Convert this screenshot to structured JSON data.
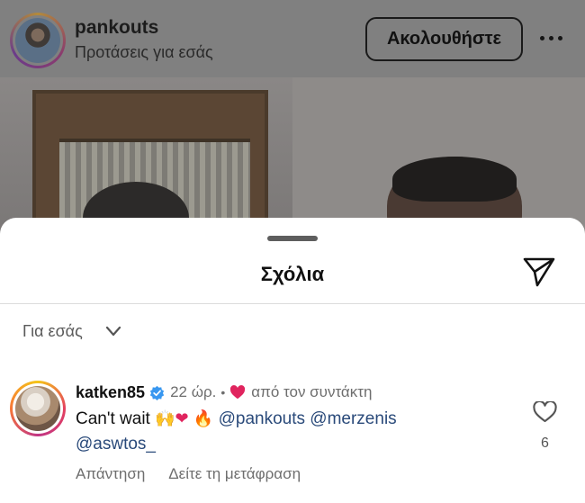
{
  "post": {
    "username": "pankouts",
    "subtitle": "Προτάσεις για εσάς",
    "follow_label": "Ακολουθήστε"
  },
  "sheet": {
    "title": "Σχόλια",
    "sort_label": "Για εσάς"
  },
  "comment": {
    "username": "katken85",
    "time": "22 ώρ.",
    "liked_by": "από τον συντάκτη",
    "text_start": "Can't wait",
    "emoji_hands": "🙌",
    "emoji_heart": "❤",
    "emoji_fire": "🔥",
    "mention_1": "@pankouts",
    "mention_2": "@merzenis",
    "mention_3": "@aswtos_",
    "like_count": "6",
    "reply_label": "Απάντηση",
    "translate_label": "Δείτε τη μετάφραση"
  },
  "colors": {
    "overlay": "#808080",
    "sheet_bg": "#ffffff",
    "verified": "#3897f0",
    "liked_heart": "#e0245e",
    "mention": "#2a4a7a",
    "secondary_text": "#6e6e6e"
  },
  "icons": {
    "more": "more-horizontal-icon",
    "share": "paper-plane-icon",
    "sort": "chevron-down-icon",
    "verified": "verified-badge-icon",
    "author_like": "heart-filled-icon",
    "like": "heart-outline-icon"
  }
}
